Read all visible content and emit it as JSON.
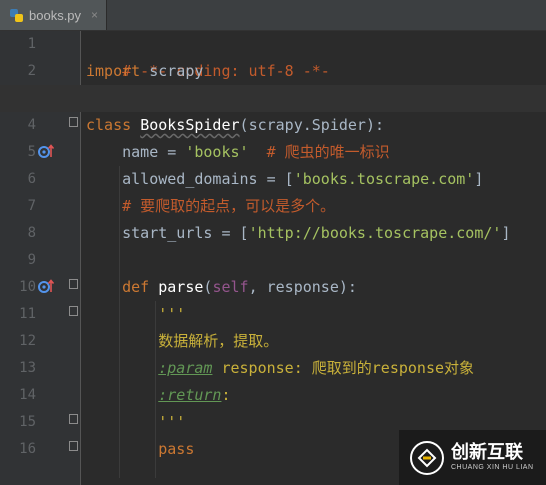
{
  "tab": {
    "filename": "books.py",
    "close_glyph": "×",
    "file_icon": "python-file-icon"
  },
  "line_numbers": [
    "1",
    "2",
    "3",
    "4",
    "5",
    "6",
    "7",
    "8",
    "9",
    "10",
    "11",
    "12",
    "13",
    "14",
    "15",
    "16"
  ],
  "code": {
    "l1": "# -*- coding: utf-8 -*-",
    "l2_kw": "import",
    "l2_rest": " scrapy",
    "l4_kw": "class",
    "l4_name": "BooksSpider",
    "l4_open": "(",
    "l4_base": "scrapy.Spider",
    "l4_close": "):",
    "l5_pre": "    name = ",
    "l5_str": "'books'",
    "l5_cm": "  # 爬虫的唯一标识",
    "l6_pre": "    allowed_domains = [",
    "l6_str": "'books.toscrape.com'",
    "l6_post": "]",
    "l7_cm": "    # 要爬取的起点，可以是多个。",
    "l8_pre": "    start_urls = [",
    "l8_str": "'http://books.toscrape.com/'",
    "l8_post": "]",
    "l10_indent": "    ",
    "l10_kw": "def",
    "l10_name": " parse",
    "l10_open": "(",
    "l10_self": "self",
    "l10_rest": ", response):",
    "l11": "        '''",
    "l12": "        数据解析，提取。",
    "l13_indent": "        ",
    "l13_tag": ":param",
    "l13_rest": " response: 爬取到的response对象",
    "l14_indent": "        ",
    "l14_tag": ":return",
    "l14_rest": ":",
    "l15": "        '''",
    "l16_indent": "        ",
    "l16_kw": "pass"
  },
  "watermark": {
    "text_cn": "创新互联",
    "text_en": "CHUANG XIN HU LIAN"
  },
  "colors": {
    "background": "#2b2b2b",
    "keyword": "#cc7832",
    "string": "#a5c261",
    "comment": "#c35b2c",
    "docstring": "#c9b13a",
    "self": "#94558d"
  }
}
